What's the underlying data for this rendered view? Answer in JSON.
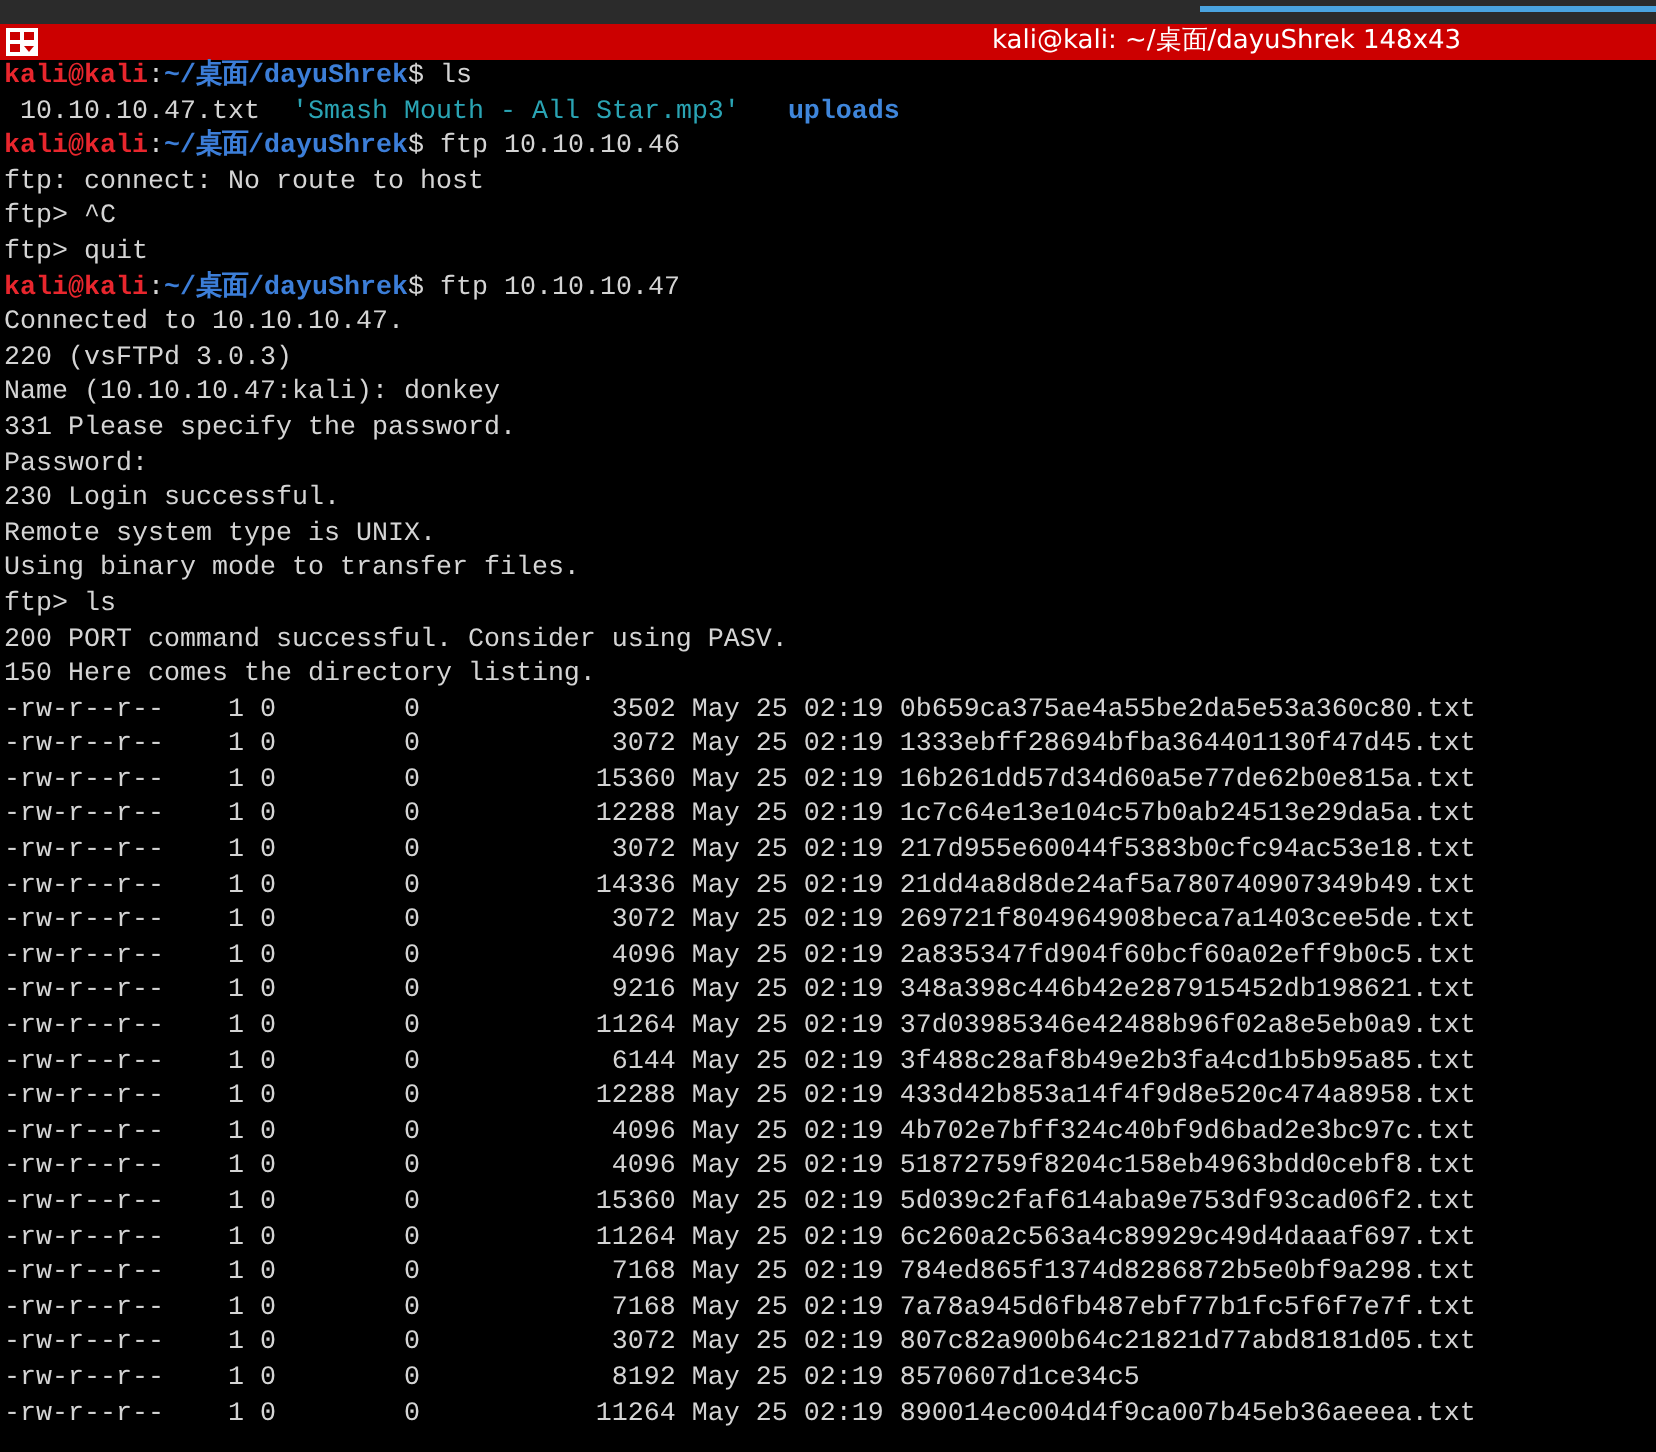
{
  "window": {
    "title": "kali@kali: ~/桌面/dayuShrek 148x43"
  },
  "lines": [
    {
      "kind": "prompt",
      "user": "kali@kali",
      "separator": ":",
      "path": "~/桌面/dayuShrek",
      "command": "$ ls"
    },
    {
      "kind": "files",
      "items": [
        {
          "kind": "file",
          "text": "10.10.10.47.txt"
        },
        {
          "kind": "audio",
          "text": "'Smash Mouth - All Star.mp3'"
        },
        {
          "kind": "folder",
          "text": "uploads"
        }
      ]
    },
    {
      "kind": "prompt",
      "user": "kali@kali",
      "separator": ":",
      "path": "~/桌面/dayuShrek",
      "command": "$ ftp 10.10.10.46"
    },
    {
      "kind": "output",
      "text": "ftp: connect: No route to host"
    },
    {
      "kind": "output",
      "text": "ftp> ^C"
    },
    {
      "kind": "output",
      "text": "ftp> quit"
    },
    {
      "kind": "prompt",
      "user": "kali@kali",
      "separator": ":",
      "path": "~/桌面/dayuShrek",
      "command": "$ ftp 10.10.10.47"
    },
    {
      "kind": "output",
      "text": "Connected to 10.10.10.47."
    },
    {
      "kind": "output",
      "text": "220 (vsFTPd 3.0.3)"
    },
    {
      "kind": "output",
      "text": "Name (10.10.10.47:kali): donkey"
    },
    {
      "kind": "output",
      "text": "331 Please specify the password."
    },
    {
      "kind": "output",
      "text": "Password:"
    },
    {
      "kind": "output",
      "text": "230 Login successful."
    },
    {
      "kind": "output",
      "text": "Remote system type is UNIX."
    },
    {
      "kind": "output",
      "text": "Using binary mode to transfer files."
    },
    {
      "kind": "output",
      "text": "ftp> ls"
    },
    {
      "kind": "output",
      "text": "200 PORT command successful. Consider using PASV."
    },
    {
      "kind": "output",
      "text": "150 Here comes the directory listing."
    }
  ],
  "listing": [
    {
      "perms": "-rw-r--r--",
      "links": "1",
      "owner": "0",
      "group": "0",
      "size": "3502",
      "date": "May 25 02:19",
      "name": "0b659ca375ae4a55be2da5e53a360c80.txt"
    },
    {
      "perms": "-rw-r--r--",
      "links": "1",
      "owner": "0",
      "group": "0",
      "size": "3072",
      "date": "May 25 02:19",
      "name": "1333ebff28694bfba364401130f47d45.txt"
    },
    {
      "perms": "-rw-r--r--",
      "links": "1",
      "owner": "0",
      "group": "0",
      "size": "15360",
      "date": "May 25 02:19",
      "name": "16b261dd57d34d60a5e77de62b0e815a.txt"
    },
    {
      "perms": "-rw-r--r--",
      "links": "1",
      "owner": "0",
      "group": "0",
      "size": "12288",
      "date": "May 25 02:19",
      "name": "1c7c64e13e104c57b0ab24513e29da5a.txt"
    },
    {
      "perms": "-rw-r--r--",
      "links": "1",
      "owner": "0",
      "group": "0",
      "size": "3072",
      "date": "May 25 02:19",
      "name": "217d955e60044f5383b0cfc94ac53e18.txt"
    },
    {
      "perms": "-rw-r--r--",
      "links": "1",
      "owner": "0",
      "group": "0",
      "size": "14336",
      "date": "May 25 02:19",
      "name": "21dd4a8d8de24af5a780740907349b49.txt"
    },
    {
      "perms": "-rw-r--r--",
      "links": "1",
      "owner": "0",
      "group": "0",
      "size": "3072",
      "date": "May 25 02:19",
      "name": "269721f804964908beca7a1403cee5de.txt"
    },
    {
      "perms": "-rw-r--r--",
      "links": "1",
      "owner": "0",
      "group": "0",
      "size": "4096",
      "date": "May 25 02:19",
      "name": "2a835347fd904f60bcf60a02eff9b0c5.txt"
    },
    {
      "perms": "-rw-r--r--",
      "links": "1",
      "owner": "0",
      "group": "0",
      "size": "9216",
      "date": "May 25 02:19",
      "name": "348a398c446b42e287915452db198621.txt"
    },
    {
      "perms": "-rw-r--r--",
      "links": "1",
      "owner": "0",
      "group": "0",
      "size": "11264",
      "date": "May 25 02:19",
      "name": "37d03985346e42488b96f02a8e5eb0a9.txt"
    },
    {
      "perms": "-rw-r--r--",
      "links": "1",
      "owner": "0",
      "group": "0",
      "size": "6144",
      "date": "May 25 02:19",
      "name": "3f488c28af8b49e2b3fa4cd1b5b95a85.txt"
    },
    {
      "perms": "-rw-r--r--",
      "links": "1",
      "owner": "0",
      "group": "0",
      "size": "12288",
      "date": "May 25 02:19",
      "name": "433d42b853a14f4f9d8e520c474a8958.txt"
    },
    {
      "perms": "-rw-r--r--",
      "links": "1",
      "owner": "0",
      "group": "0",
      "size": "4096",
      "date": "May 25 02:19",
      "name": "4b702e7bff324c40bf9d6bad2e3bc97c.txt"
    },
    {
      "perms": "-rw-r--r--",
      "links": "1",
      "owner": "0",
      "group": "0",
      "size": "4096",
      "date": "May 25 02:19",
      "name": "51872759f8204c158eb4963bdd0cebf8.txt"
    },
    {
      "perms": "-rw-r--r--",
      "links": "1",
      "owner": "0",
      "group": "0",
      "size": "15360",
      "date": "May 25 02:19",
      "name": "5d039c2faf614aba9e753df93cad06f2.txt"
    },
    {
      "perms": "-rw-r--r--",
      "links": "1",
      "owner": "0",
      "group": "0",
      "size": "11264",
      "date": "May 25 02:19",
      "name": "6c260a2c563a4c89929c49d4daaaf697.txt"
    },
    {
      "perms": "-rw-r--r--",
      "links": "1",
      "owner": "0",
      "group": "0",
      "size": "7168",
      "date": "May 25 02:19",
      "name": "784ed865f1374d8286872b5e0bf9a298.txt"
    },
    {
      "perms": "-rw-r--r--",
      "links": "1",
      "owner": "0",
      "group": "0",
      "size": "7168",
      "date": "May 25 02:19",
      "name": "7a78a945d6fb487ebf77b1fc5f6f7e7f.txt"
    },
    {
      "perms": "-rw-r--r--",
      "links": "1",
      "owner": "0",
      "group": "0",
      "size": "3072",
      "date": "May 25 02:19",
      "name": "807c82a900b64c21821d77abd8181d05.txt"
    },
    {
      "perms": "-rw-r--r--",
      "links": "1",
      "owner": "0",
      "group": "0",
      "size": "8192",
      "date": "May 25 02:19",
      "name": "8570607d1ce34c5"
    },
    {
      "perms": "-rw-r--r--",
      "links": "1",
      "owner": "0",
      "group": "0",
      "size": "11264",
      "date": "May 25 02:19",
      "name": "890014ec004d4f9ca007b45eb36aeeea.txt"
    }
  ]
}
